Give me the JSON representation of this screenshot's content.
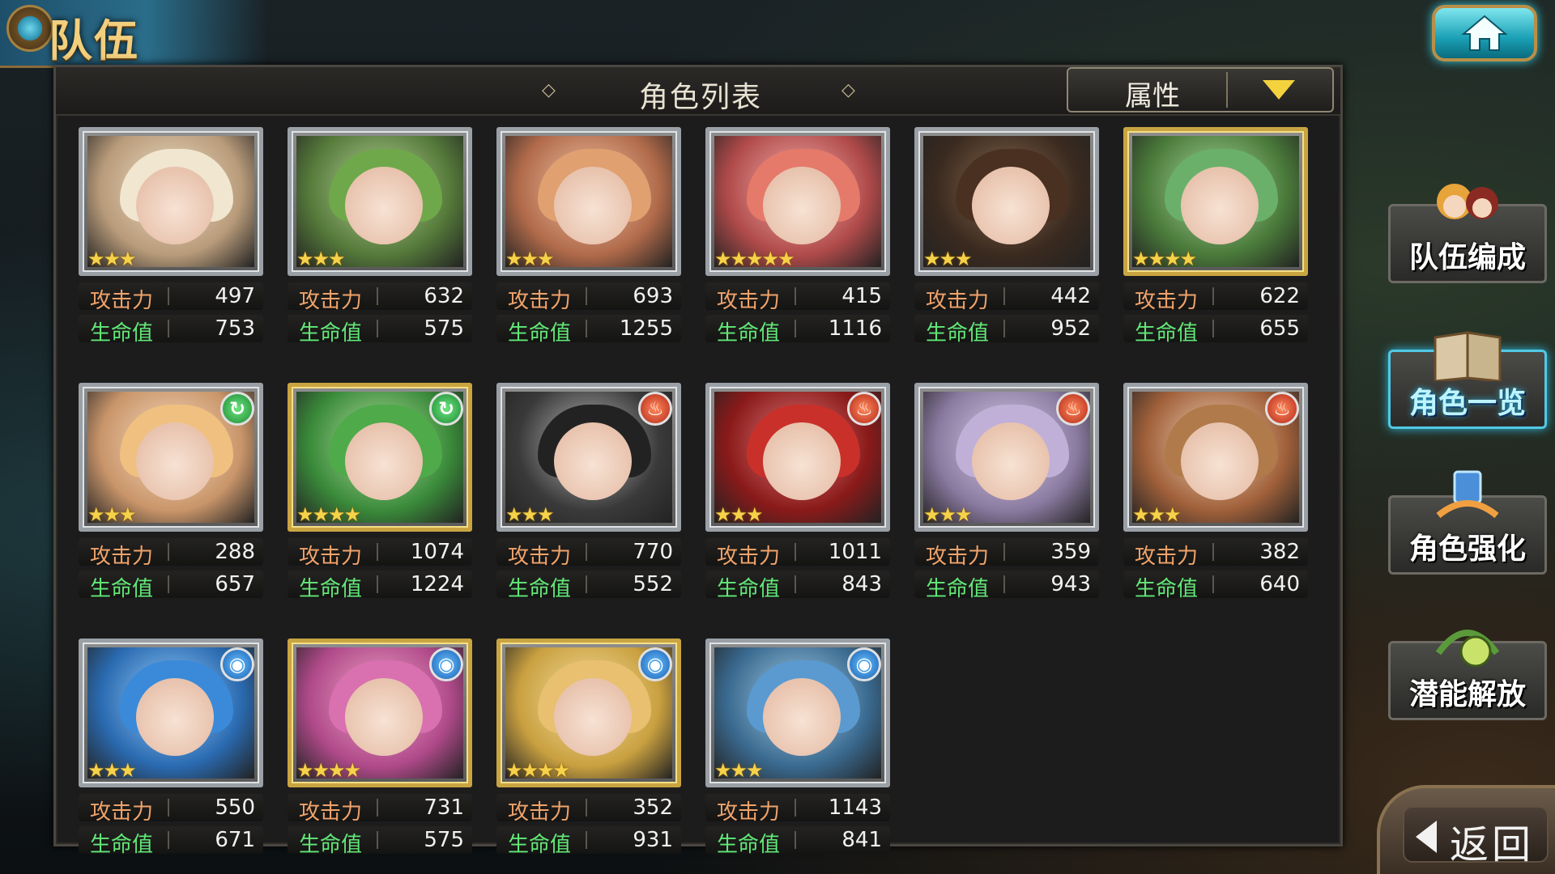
{
  "header": {
    "title": "队伍"
  },
  "panel": {
    "list_title": "角色列表",
    "filter_label": "属性"
  },
  "stat_labels": {
    "attack": "攻击力",
    "hp": "生命值"
  },
  "side_menu": [
    {
      "label": "队伍编成",
      "icon": "team-portraits-icon"
    },
    {
      "label": "角色一览",
      "icon": "book-icon",
      "active": true
    },
    {
      "label": "角色强化",
      "icon": "crystal-icon"
    },
    {
      "label": "潜能解放",
      "icon": "orb-icon"
    }
  ],
  "back": {
    "label": "返回"
  },
  "characters": [
    {
      "atk": "497",
      "hp": "753",
      "stars": 3,
      "frame": "silver",
      "element": ""
    },
    {
      "atk": "632",
      "hp": "575",
      "stars": 3,
      "frame": "silver",
      "element": ""
    },
    {
      "atk": "693",
      "hp": "1255",
      "stars": 3,
      "frame": "silver",
      "element": ""
    },
    {
      "atk": "415",
      "hp": "1116",
      "stars": 5,
      "frame": "silver",
      "element": ""
    },
    {
      "atk": "442",
      "hp": "952",
      "stars": 3,
      "frame": "silver",
      "element": ""
    },
    {
      "atk": "622",
      "hp": "655",
      "stars": 4,
      "frame": "gold",
      "element": ""
    },
    {
      "atk": "288",
      "hp": "657",
      "stars": 3,
      "frame": "silver",
      "element": "wind"
    },
    {
      "atk": "1074",
      "hp": "1224",
      "stars": 4,
      "frame": "gold",
      "element": "wind"
    },
    {
      "atk": "770",
      "hp": "552",
      "stars": 3,
      "frame": "silver",
      "element": "fire"
    },
    {
      "atk": "1011",
      "hp": "843",
      "stars": 3,
      "frame": "silver",
      "element": "fire"
    },
    {
      "atk": "359",
      "hp": "943",
      "stars": 3,
      "frame": "silver",
      "element": "fire"
    },
    {
      "atk": "382",
      "hp": "640",
      "stars": 3,
      "frame": "silver",
      "element": "fire"
    },
    {
      "atk": "550",
      "hp": "671",
      "stars": 3,
      "frame": "silver",
      "element": "water"
    },
    {
      "atk": "731",
      "hp": "575",
      "stars": 4,
      "frame": "gold",
      "element": "water"
    },
    {
      "atk": "352",
      "hp": "931",
      "stars": 4,
      "frame": "gold",
      "element": "water"
    },
    {
      "atk": "1143",
      "hp": "841",
      "stars": 3,
      "frame": "silver",
      "element": "water"
    }
  ]
}
